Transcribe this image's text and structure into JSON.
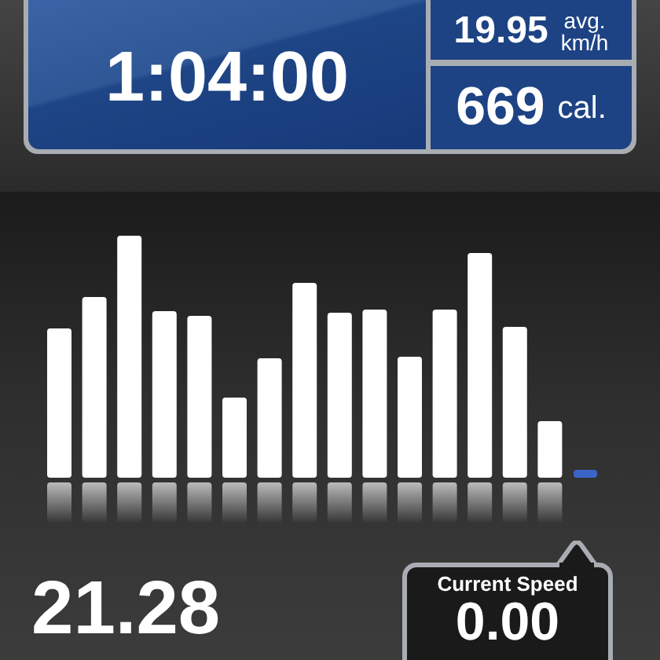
{
  "timer": {
    "elapsed": "1:04:00"
  },
  "stats": [
    {
      "value": "19.95",
      "unit_lines": [
        "avg.",
        "km/h"
      ]
    },
    {
      "value": "669",
      "unit_lines": [
        "cal."
      ]
    }
  ],
  "distance": "21.28",
  "current_speed": {
    "label": "Current Speed",
    "value": "0.00"
  }
}
